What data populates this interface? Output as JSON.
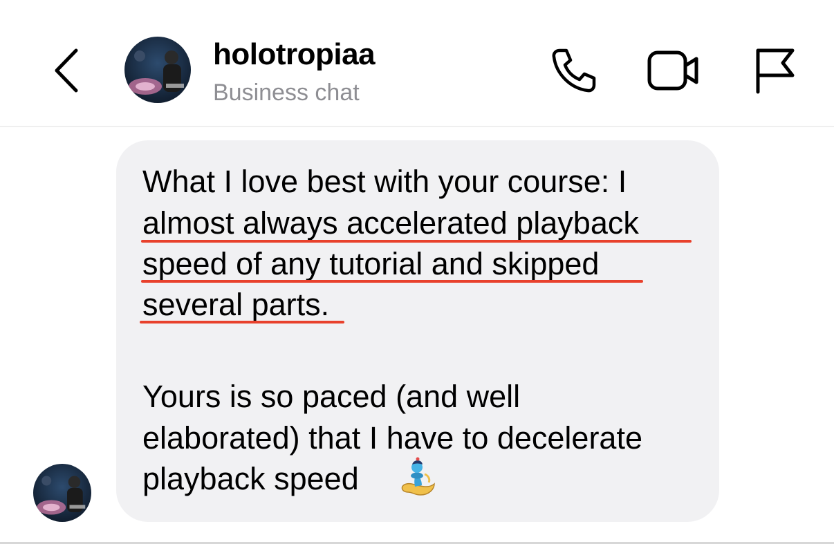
{
  "header": {
    "username": "holotropiaa",
    "subtitle": "Business chat",
    "icons": [
      "chevron-left-icon",
      "phone-icon",
      "video-camera-icon",
      "flag-icon"
    ]
  },
  "message": {
    "lines": [
      "What I love best with your course: I",
      "almost always accelerated playback",
      "speed of any tutorial and skipped",
      "several parts.",
      "Yours is so paced (and well",
      "elaborated) that I have to decelerate",
      "playback speed"
    ],
    "emoji": "genie-emoji",
    "underline_color": "#e8412c",
    "bubble_color": "#f1f1f3"
  }
}
